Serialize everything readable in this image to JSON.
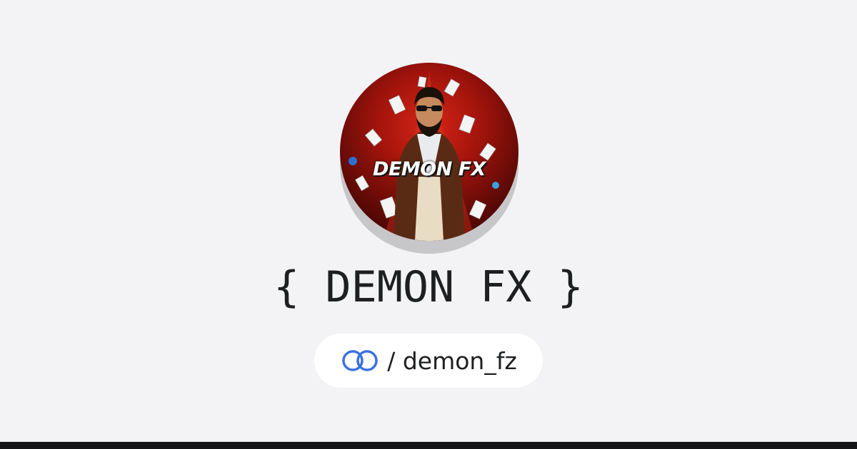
{
  "profile": {
    "avatar_caption": "DEMON FX",
    "display_name": "{ DEMON FX }",
    "handle": "/ demon_fz"
  },
  "icons": {
    "handle_icon": "linked-rings-icon"
  },
  "colors": {
    "background": "#f3f3f5",
    "text": "#1e1f21",
    "accent": "#3b72e0",
    "bottom_bar": "#151617"
  }
}
